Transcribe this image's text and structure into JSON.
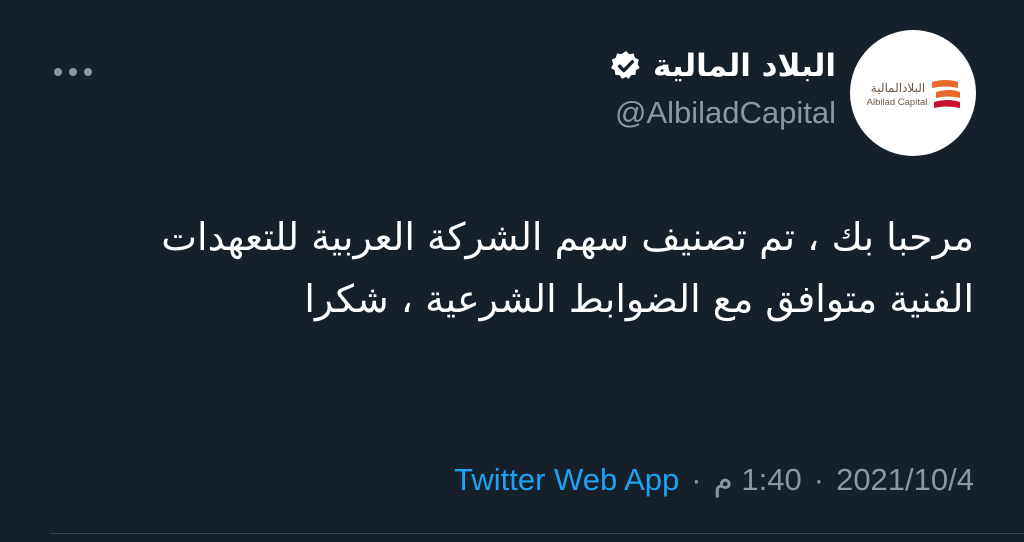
{
  "author": {
    "display_name": "البلاد المالية",
    "handle": "@AlbiladCapital",
    "verified": true,
    "avatar_logo_arabic": "البلادالمالية",
    "avatar_logo_latin": "Albilad Capital"
  },
  "tweet": {
    "text": "مرحبا بك ، تم تصنيف سهم الشركة العربية للتعهدات الفنية متوافق مع الضوابط الشرعية ، شكرا"
  },
  "meta": {
    "date": "2021/10/4",
    "time": "1:40 م",
    "separator": "·",
    "source": "Twitter Web App"
  },
  "icons": {
    "more": "more-options-icon",
    "verified": "verified-badge-icon"
  },
  "colors": {
    "background": "#15202b",
    "link": "#1da1f2",
    "secondary_text": "#8899a6",
    "logo_orange": "#e8692a",
    "logo_red": "#c8102e"
  }
}
